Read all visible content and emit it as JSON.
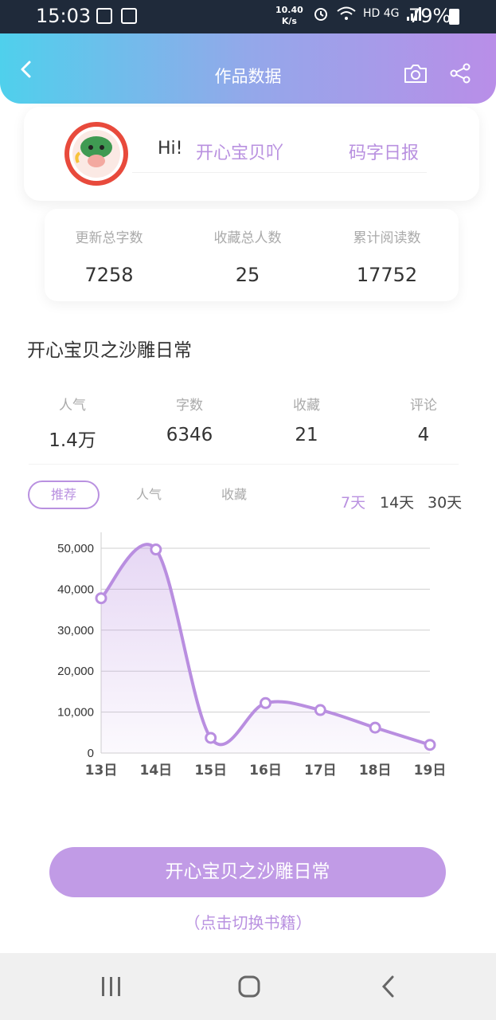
{
  "status_bar": {
    "time": "15:03",
    "net_speed_top": "10.40",
    "net_speed_bottom": "K/s",
    "network_tags": "HD 4G",
    "battery": "79%"
  },
  "header": {
    "title": "作品数据"
  },
  "user": {
    "greeting": "Hi!",
    "name": "开心宝贝吖",
    "report_link": "码字日报"
  },
  "totals": [
    {
      "label": "更新总字数",
      "value": "7258"
    },
    {
      "label": "收藏总人数",
      "value": "25"
    },
    {
      "label": "累计阅读数",
      "value": "17752"
    }
  ],
  "book": {
    "title": "开心宝贝之沙雕日常",
    "metrics": [
      {
        "label": "人气",
        "value": "1.4万"
      },
      {
        "label": "字数",
        "value": "6346"
      },
      {
        "label": "收藏",
        "value": "21"
      },
      {
        "label": "评论",
        "value": "4"
      }
    ]
  },
  "tabs": [
    {
      "label": "推荐",
      "active": true
    },
    {
      "label": "人气",
      "active": false
    },
    {
      "label": "收藏",
      "active": false
    }
  ],
  "ranges": [
    {
      "label": "7天",
      "active": true
    },
    {
      "label": "14天",
      "active": false
    },
    {
      "label": "30天",
      "active": false
    }
  ],
  "chart_data": {
    "type": "area",
    "categories": [
      "13日",
      "14日",
      "15日",
      "16日",
      "17日",
      "18日",
      "19日"
    ],
    "values": [
      37800,
      49700,
      3700,
      12200,
      10500,
      6200,
      2000
    ],
    "ylim": [
      0,
      50000
    ],
    "yticks": [
      0,
      10000,
      20000,
      30000,
      40000,
      50000
    ],
    "ytick_labels": [
      "0",
      "10,000",
      "20,000",
      "30,000",
      "40,000",
      "50,000"
    ],
    "grid": true,
    "color": "#b98ee0"
  },
  "footer": {
    "book_button": "开心宝贝之沙雕日常",
    "switch_hint": "（点击切换书籍）"
  },
  "colors": {
    "accent": "#b991e0",
    "header_gradient_start": "#4fd0ec",
    "header_gradient_end": "#b98ee8"
  },
  "icons": [
    "image-icon",
    "record-icon",
    "alarm-icon",
    "wifi-icon",
    "signal-icon",
    "battery-icon",
    "back-arrow-icon",
    "camera-icon",
    "share-icon",
    "avatar-image",
    "recent-apps-icon",
    "home-icon",
    "nav-back-icon"
  ]
}
